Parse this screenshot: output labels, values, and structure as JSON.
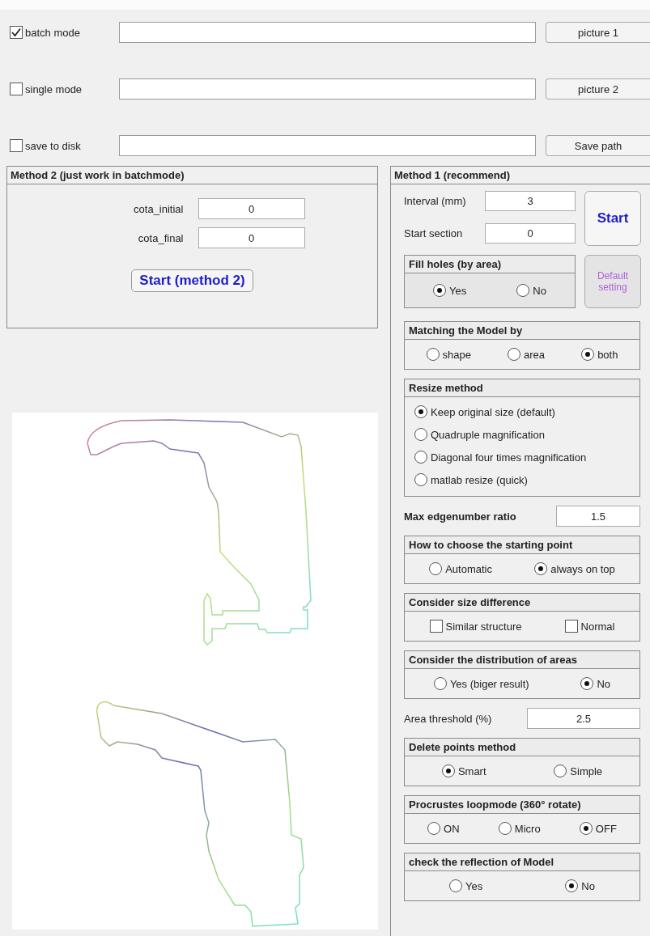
{
  "top_rows": [
    {
      "label": "batch mode",
      "checked": true,
      "button": "picture 1"
    },
    {
      "label": "single mode",
      "checked": false,
      "button": "picture 2"
    },
    {
      "label": "save to disk",
      "checked": false,
      "button": "Save path"
    }
  ],
  "method2": {
    "title": "Method 2 (just work in batchmode)",
    "fields": [
      {
        "label": "cota_initial",
        "value": "0"
      },
      {
        "label": "cota_final",
        "value": "0"
      }
    ],
    "button": "Start (method 2)"
  },
  "method1": {
    "title": "Method 1  (recommend)",
    "fields": [
      {
        "label": "Interval (mm)",
        "value": "3"
      },
      {
        "label": "Start section",
        "value": "0"
      }
    ],
    "start_button": "Start",
    "fill_holes": {
      "title": "Fill holes  (by area)",
      "options": [
        {
          "label": "Yes",
          "selected": true
        },
        {
          "label": "No",
          "selected": false
        }
      ]
    },
    "default_button": "Default setting",
    "settings": [
      {
        "kind": "radio",
        "title": "Matching the Model by",
        "options": [
          {
            "label": "shape",
            "selected": false
          },
          {
            "label": "area",
            "selected": false
          },
          {
            "label": "both",
            "selected": true
          }
        ]
      },
      {
        "kind": "radio-list",
        "title": "Resize method",
        "options": [
          {
            "label": "Keep original size (default)",
            "selected": true
          },
          {
            "label": "Quadruple magnification",
            "selected": false
          },
          {
            "label": "Diagonal four times magnification",
            "selected": false
          },
          {
            "label": "matlab resize (quick)",
            "selected": false
          }
        ]
      },
      {
        "kind": "field",
        "label": "Max edgenumber  ratio",
        "value": "1.5",
        "bold": true
      },
      {
        "kind": "radio",
        "title": "How to choose the starting point",
        "options": [
          {
            "label": "Automatic",
            "selected": false
          },
          {
            "label": "always on top",
            "selected": true
          }
        ]
      },
      {
        "kind": "checkbox",
        "title": "Consider size difference",
        "options": [
          {
            "label": "Similar structure",
            "checked": false
          },
          {
            "label": "Normal",
            "checked": false
          }
        ]
      },
      {
        "kind": "radio",
        "title": "Consider the distribution of areas",
        "options": [
          {
            "label": "Yes (biger result)",
            "selected": false
          },
          {
            "label": "No",
            "selected": true
          }
        ]
      },
      {
        "kind": "field",
        "label": "Area threshold (%)",
        "value": "2.5",
        "bold": false
      },
      {
        "kind": "radio",
        "title": "Delete points method",
        "options": [
          {
            "label": "Smart",
            "selected": true
          },
          {
            "label": "Simple",
            "selected": false
          }
        ]
      },
      {
        "kind": "radio",
        "title": "Procrustes loopmode  (360° rotate)",
        "options": [
          {
            "label": "ON",
            "selected": false
          },
          {
            "label": "Micro",
            "selected": false
          },
          {
            "label": "OFF",
            "selected": true
          }
        ]
      },
      {
        "kind": "radio",
        "title": "check the reflection of Model",
        "options": [
          {
            "label": "Yes",
            "selected": false
          },
          {
            "label": "No",
            "selected": true
          }
        ]
      }
    ]
  }
}
